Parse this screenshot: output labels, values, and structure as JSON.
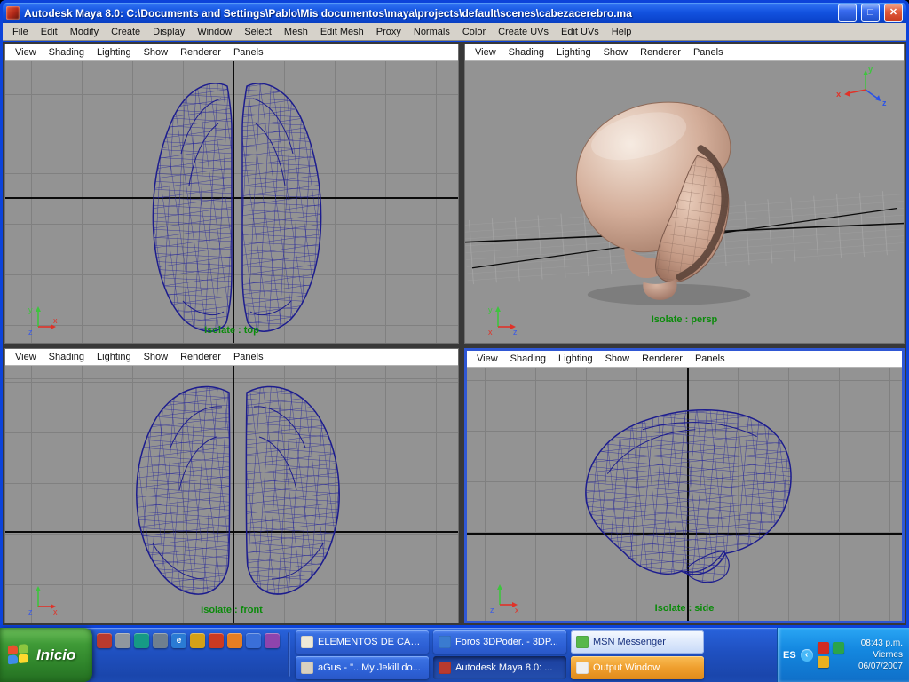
{
  "window": {
    "title": "Autodesk Maya 8.0: C:\\Documents and Settings\\Pablo\\Mis documentos\\maya\\projects\\default\\scenes\\cabezacerebro.ma",
    "controls": {
      "minimize": "_",
      "maximize": "□",
      "close": "✕"
    }
  },
  "menubar": {
    "items": [
      "File",
      "Edit",
      "Modify",
      "Create",
      "Display",
      "Window",
      "Select",
      "Mesh",
      "Edit Mesh",
      "Proxy",
      "Normals",
      "Color",
      "Create UVs",
      "Edit UVs",
      "Help"
    ]
  },
  "panel_menu": {
    "items": [
      "View",
      "Shading",
      "Lighting",
      "Show",
      "Renderer",
      "Panels"
    ]
  },
  "viewports": {
    "top": {
      "label": "Isolate : top"
    },
    "persp": {
      "label": "Isolate : persp"
    },
    "front": {
      "label": "Isolate : front"
    },
    "side": {
      "label": "Isolate : side"
    }
  },
  "axis_letters": {
    "up": "y",
    "right": "x",
    "depth": "z"
  },
  "colors": {
    "wireframe": "#1c1c8e",
    "viewport_bg": "#939393",
    "grid_line": "#808080",
    "label_green": "#0b8b0b",
    "active_panel_border": "#2f57d4",
    "taskbar_blue": "#1f50c0",
    "alert_orange": "#ef9f2e"
  },
  "taskbar": {
    "start_label": "Inicio",
    "quick_launch": [
      {
        "style": "background:#b93a2e"
      },
      {
        "style": "background:#8f979e"
      },
      {
        "style": "background:#169a85"
      },
      {
        "style": "background:#6f7f8f"
      },
      {
        "style": "background:#2a7bd4",
        "glyph": "e"
      },
      {
        "style": "background:#d4a017"
      },
      {
        "style": "background:#cc3a22"
      },
      {
        "style": "background:#e67e22"
      },
      {
        "style": "background:#3a6fd8"
      },
      {
        "style": "background:#8e44ad"
      }
    ],
    "buttons": {
      "row1": [
        {
          "label": "ELEMENTOS DE CALC...",
          "icon_style": "background:#efe9d8"
        },
        {
          "label": "Foros 3DPoder. - 3DP...",
          "icon_style": "background:#3a7bd0"
        },
        {
          "label": "MSN Messenger",
          "icon_style": "background:#58b84a"
        }
      ],
      "row2": [
        {
          "label": "aGus - \"...My Jekill do...",
          "icon_style": "background:#d8d0c0"
        },
        {
          "label": "Autodesk Maya 8.0: ...",
          "icon_style": "background:#b93a2e"
        },
        {
          "label": "Output Window",
          "icon_style": "background:#f0f0f0"
        }
      ]
    },
    "tray": {
      "lang": "ES",
      "chevron": "‹",
      "icons": [
        {
          "style": "background:#d22c20"
        },
        {
          "style": "background:#2ba44a"
        },
        {
          "style": "background:#e8b01f"
        }
      ],
      "clock": {
        "time": "08:43 p.m.",
        "day": "Viernes",
        "date": "06/07/2007"
      }
    }
  }
}
